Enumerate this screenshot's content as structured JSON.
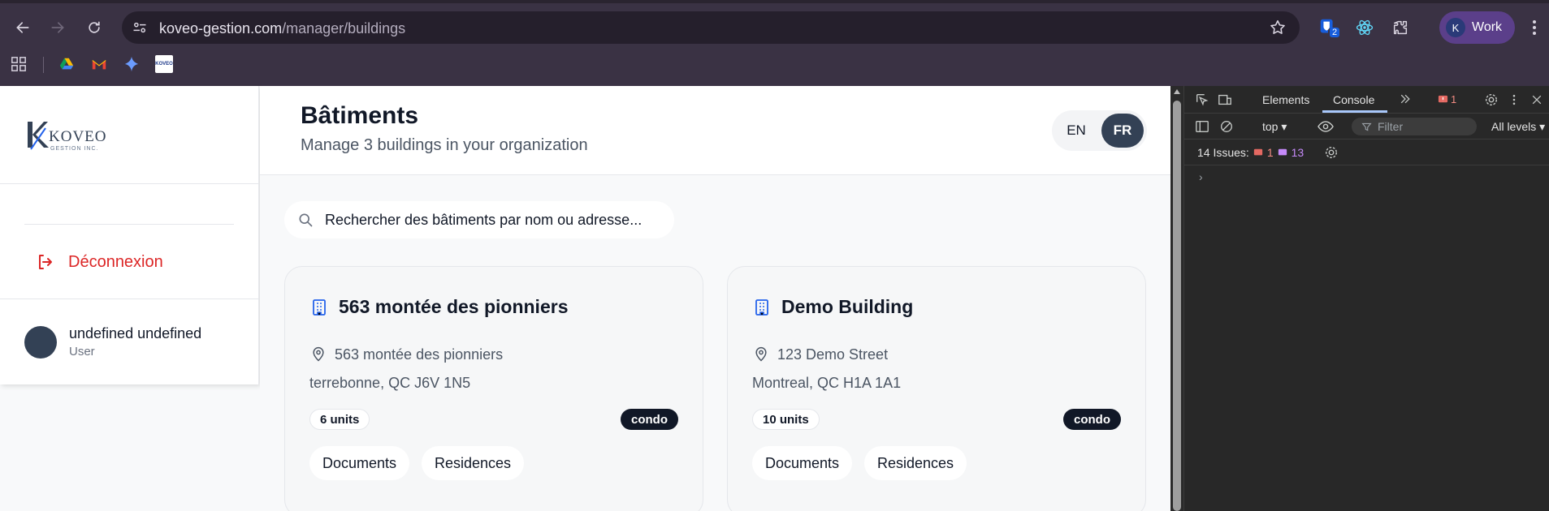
{
  "browser": {
    "url_host": "koveo-gestion.com",
    "url_path": "/manager/buildings",
    "extension_badge": "2",
    "profile_initial": "K",
    "profile_label": "Work",
    "bookmark_logo_text": "KOVEO"
  },
  "sidebar": {
    "logo_text": "KOVEO",
    "logo_subtext": "GESTION INC.",
    "logout_label": "Déconnexion",
    "user_name": "undefined undefined",
    "user_role": "User"
  },
  "header": {
    "title": "Bâtiments",
    "subtitle": "Manage 3 buildings in your organization",
    "lang_en": "EN",
    "lang_fr": "FR"
  },
  "search": {
    "placeholder": "Rechercher des bâtiments par nom ou adresse..."
  },
  "buildings": [
    {
      "name": "563 montée des pionniers",
      "address_line1": "563 montée des pionniers",
      "address_line2": "terrebonne, QC J6V 1N5",
      "units": "6 units",
      "type": "condo",
      "documents_label": "Documents",
      "residences_label": "Residences"
    },
    {
      "name": "Demo Building",
      "address_line1": "123 Demo Street",
      "address_line2": "Montreal, QC H1A 1A1",
      "units": "10 units",
      "type": "condo",
      "documents_label": "Documents",
      "residences_label": "Residences"
    }
  ],
  "devtools": {
    "tab_elements": "Elements",
    "tab_console": "Console",
    "error_count": "1",
    "context": "top ▾",
    "filter_placeholder": "Filter",
    "levels": "All levels ▾",
    "issues_label": "14 Issues:",
    "issues_errors": "1",
    "issues_warnings": "13",
    "prompt": "›"
  },
  "colors": {
    "accent_blue": "#2563eb",
    "danger": "#dc2626",
    "dark": "#334155"
  }
}
